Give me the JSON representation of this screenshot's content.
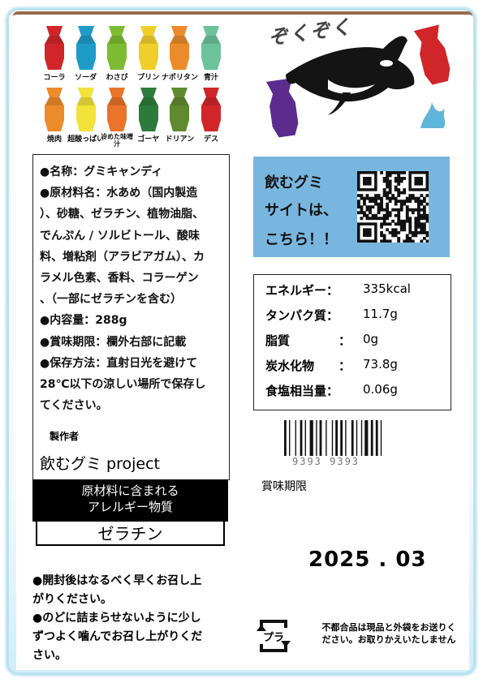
{
  "flavors_row1": [
    {
      "label": "コーラ",
      "color": "#d0262a"
    },
    {
      "label": "ソーダ",
      "color": "#1f9bc8"
    },
    {
      "label": "わさび",
      "color": "#7dbb32"
    },
    {
      "label": "プリン",
      "color": "#f1cf2b"
    },
    {
      "label": "ナポリタン",
      "color": "#ec8b2b"
    },
    {
      "label": "青汁",
      "color": "#6cc39b"
    }
  ],
  "flavors_row2": [
    {
      "label": "焼肉",
      "color": "#ec8b2b"
    },
    {
      "label": "超酸っぱい",
      "color": "#f2e23a"
    },
    {
      "label": "冷めた味噌汁",
      "color": "#e9742a"
    },
    {
      "label": "ゴーヤ",
      "color": "#2c7b3b"
    },
    {
      "label": "ドリアン",
      "color": "#5f8a2f"
    },
    {
      "label": "デス",
      "color": "#d0262a"
    }
  ],
  "brand_title": "ぞくぞく",
  "info": {
    "lines": [
      "●名称：グミキャンディ",
      "●原材料名：水あめ（国内製造",
      "）、砂糖、ゼラチン、植物油脂、",
      "でんぷん / ソルビトール、酸味",
      "料、増粘剤（アラビアガム）、カ",
      "ラメル色素、香料、コラーゲン",
      "、（一部にゼラチンを含む）",
      "●内容量：288g",
      "●賞味期限：欄外右部に記載",
      "●保存方法：直射日光を避けて",
      "28℃以下の涼しい場所で保存し",
      "てください。"
    ],
    "maker_label": "製作者",
    "maker_name": "飲むグミ project"
  },
  "allergy": {
    "heading_line1": "原材料に含まれる",
    "heading_line2": "アレルギー物質",
    "value": "ゼラチン"
  },
  "notes": [
    "●開封後はなるべく早くお召し上",
    "がりください。",
    "●のどに詰まらせないように少し",
    "ずつよく噛んでお召し上がりくだ",
    "さい。"
  ],
  "qr": {
    "line1": "飲むグミ",
    "line2": "サイトは、",
    "line3": "こちら！！"
  },
  "nutrition": [
    {
      "name": "エネルギー：",
      "colon": "",
      "value": "335kcal"
    },
    {
      "name": "タンパク質：",
      "colon": "",
      "value": "11.7g"
    },
    {
      "name": "脂質",
      "colon": "：",
      "value": "0g"
    },
    {
      "name": "炭水化物",
      "colon": "：",
      "value": "73.8g"
    },
    {
      "name": "食塩相当量：",
      "colon": "",
      "value": "0.06g"
    }
  ],
  "barcode_number": "9393 9393",
  "best_before_label": "賞味期限",
  "best_before_date": "2025 . 03",
  "recycle_mark": "プラ",
  "defect_notice": "不都合品は現品と外袋をお送りください。お取りかえいたしません"
}
